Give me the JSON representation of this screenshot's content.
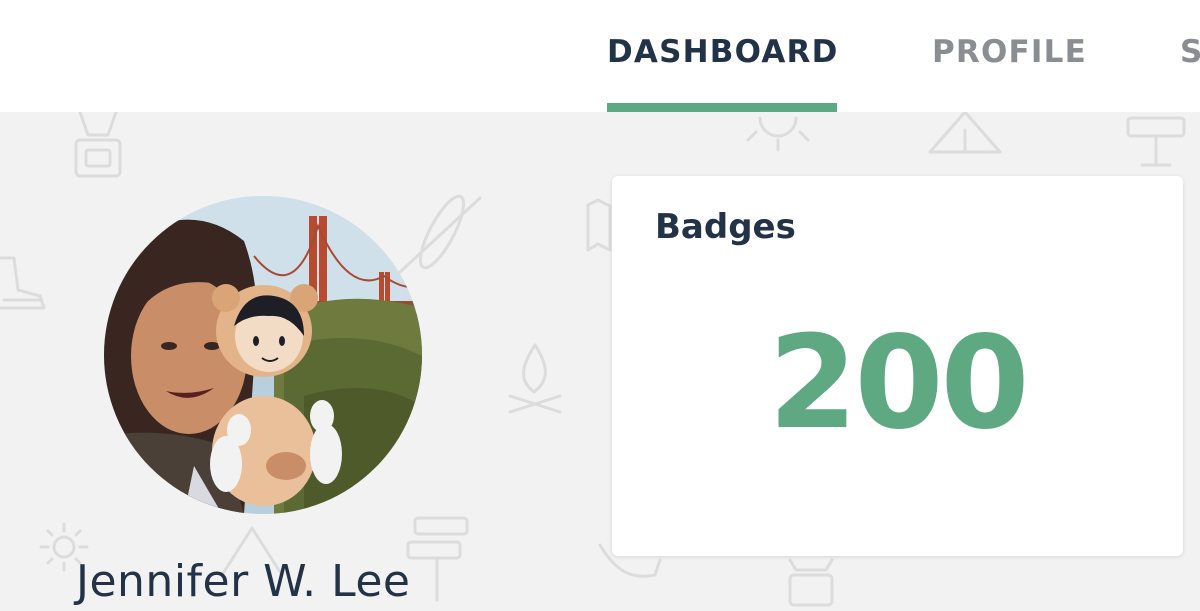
{
  "nav": {
    "tabs": [
      {
        "label": "DASHBOARD",
        "active": true
      },
      {
        "label": "PROFILE",
        "active": false
      },
      {
        "label": "S",
        "active": false
      }
    ],
    "active_color": "#5ea982"
  },
  "profile": {
    "name": "Jennifer W. Lee"
  },
  "badges_card": {
    "title": "Badges",
    "value": "200",
    "value_color": "#5ea982"
  },
  "background": {
    "icons": [
      "lantern-icon",
      "sun-icon",
      "tent-icon",
      "signpost-icon",
      "hiking-boot-icon",
      "kayak-icon",
      "map-icon",
      "campfire-icon"
    ]
  }
}
